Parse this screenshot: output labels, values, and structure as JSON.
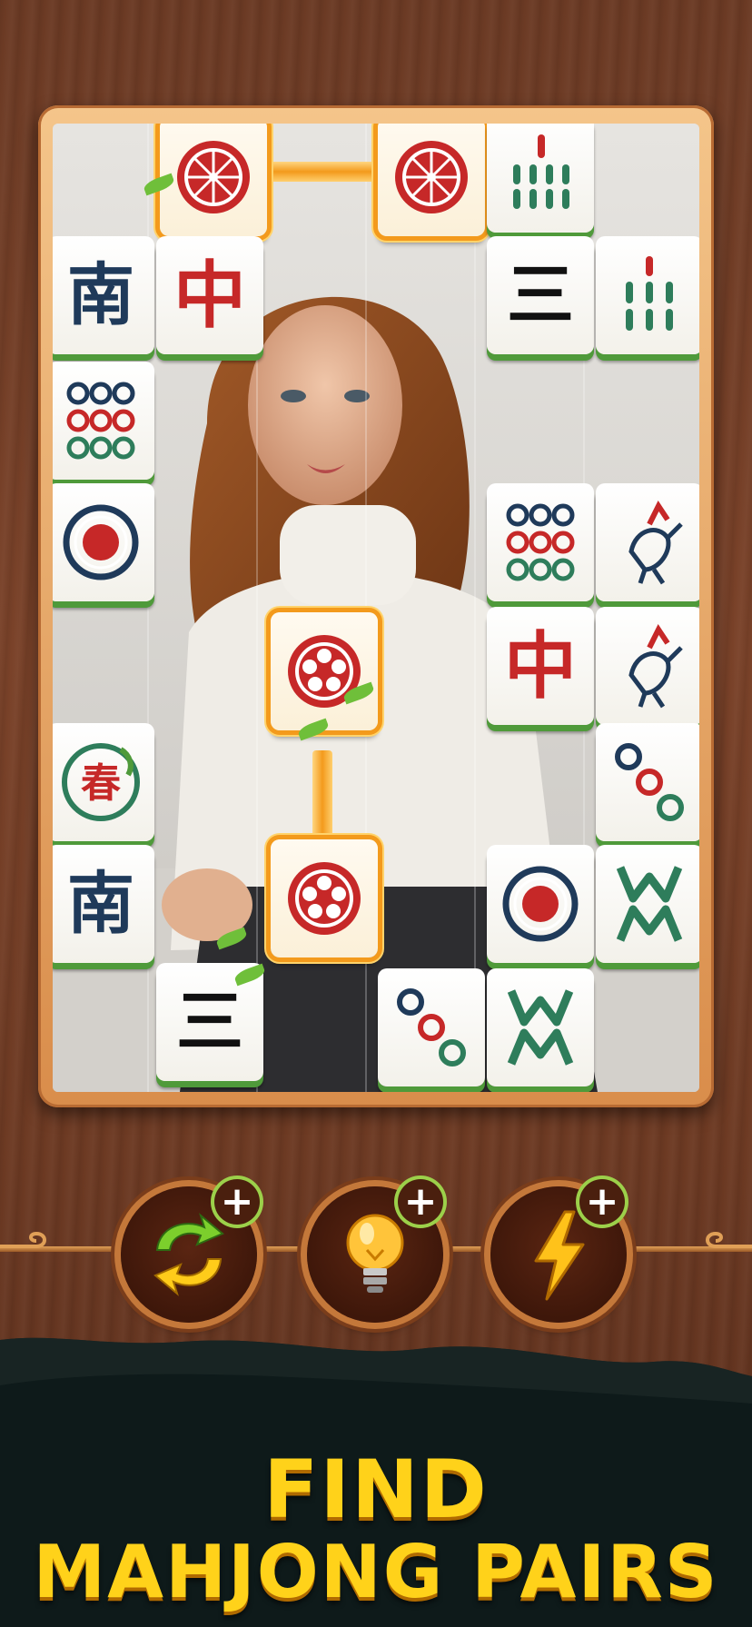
{
  "headline": {
    "line1": "FIND",
    "line2": "MAHJONG PAIRS"
  },
  "powerups": [
    {
      "name": "shuffle",
      "icon": "shuffle-arrows-icon",
      "plus": "+"
    },
    {
      "name": "hint",
      "icon": "lightbulb-icon",
      "plus": "+"
    },
    {
      "name": "boost",
      "icon": "lightning-icon",
      "plus": "+"
    }
  ],
  "tiles": {
    "south": "南",
    "red_dragon": "中",
    "three": "三",
    "spring": "春"
  },
  "colors": {
    "tile_red": "#c62828",
    "tile_blue": "#1f3a5a",
    "tile_green": "#2e7d5b",
    "tile_base_green": "#4f9a3a",
    "highlight_orange": "#f39a1c",
    "headline_yellow": "#ffd21a",
    "board_frame": "#e8a868"
  }
}
